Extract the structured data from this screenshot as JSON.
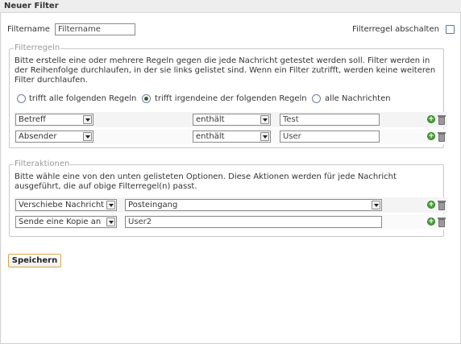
{
  "dialog": {
    "title": "Neuer Filter"
  },
  "filter": {
    "name_label": "Filtername",
    "name_value": "Filtername",
    "disable_label": "Filterregel abschalten"
  },
  "rules": {
    "legend": "Filterregeln",
    "description": "Bitte erstelle eine oder mehrere Regeln gegen die jede Nachricht getestet werden soll. Filter werden in der Reihenfolge durchlaufen, in der sie links gelistet sind. Wenn ein Filter zutrifft, werden keine weiteren Filter durchlaufen.",
    "match_options": [
      "trifft alle folgenden Regeln",
      "trifft irgendeine der folgenden Regeln",
      "alle Nachrichten"
    ],
    "selected_match": "trifft irgendeine der folgenden Regeln",
    "rows": [
      {
        "field": "Betreff",
        "operator": "enthält",
        "value": "Test"
      },
      {
        "field": "Absender",
        "operator": "enthält",
        "value": "User"
      }
    ]
  },
  "actions": {
    "legend": "Filteraktionen",
    "description": "Bitte wähle eine von den unten gelisteten Optionen. Diese Aktionen werden für jede Nachricht ausgeführt, die auf obige Filterregel(n) passt.",
    "rows": [
      {
        "action": "Verschiebe Nachricht",
        "target": "Posteingang"
      },
      {
        "action": "Sende eine Kopie an",
        "target": "User2"
      }
    ]
  },
  "save_label": "Speichern",
  "icons": {
    "add": "add-icon",
    "delete": "trash-icon"
  },
  "colors": {
    "save_border": "#d8a64a",
    "add_green": "#4aa33a",
    "radio_dot": "#3a5f2c"
  }
}
